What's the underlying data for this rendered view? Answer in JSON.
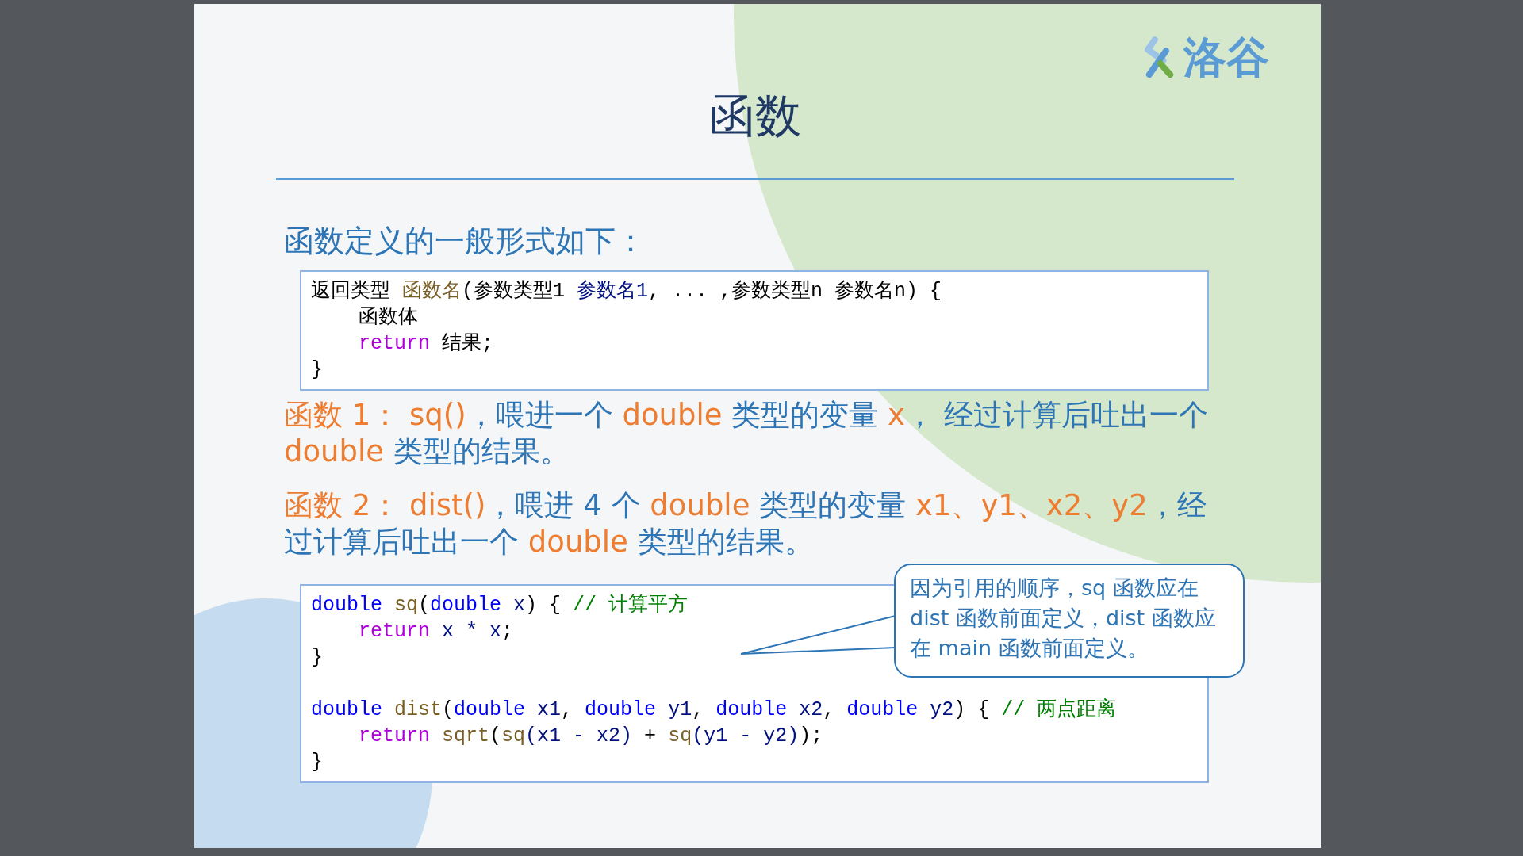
{
  "slide": {
    "logo": {
      "text": "洛谷"
    },
    "title": "函数",
    "heading": "函数定义的一般形式如下：",
    "code_blocks": [
      {
        "lines": [
          {
            "kind": "flush",
            "tokens": [
              {
                "kind": "plain",
                "text": "返回类型 "
              },
              {
                "kind": "func",
                "text": "函数名"
              },
              {
                "kind": "plain",
                "text": "(参数类型1 "
              },
              {
                "kind": "param",
                "text": "参数名1"
              },
              {
                "kind": "plain",
                "text": ", ... ,参数类型n 参数名n) {"
              }
            ]
          },
          {
            "kind": "indented",
            "tokens": [
              {
                "kind": "plain",
                "text": "函数体"
              }
            ]
          },
          {
            "kind": "indented",
            "tokens": [
              {
                "kind": "keyword",
                "text": "return"
              },
              {
                "kind": "plain",
                "text": " 结果;"
              }
            ]
          },
          {
            "kind": "flush",
            "tokens": [
              {
                "kind": "plain",
                "text": "}"
              }
            ]
          }
        ]
      },
      {
        "lines": [
          {
            "kind": "flush",
            "tokens": [
              {
                "kind": "type",
                "text": "double "
              },
              {
                "kind": "func",
                "text": "sq"
              },
              {
                "kind": "plain",
                "text": "("
              },
              {
                "kind": "type",
                "text": "double"
              },
              {
                "kind": "param",
                "text": " x"
              },
              {
                "kind": "plain",
                "text": ") { "
              },
              {
                "kind": "comment",
                "text": "// 计算平方"
              }
            ]
          },
          {
            "kind": "indented",
            "tokens": [
              {
                "kind": "keyword",
                "text": "return"
              },
              {
                "kind": "param",
                "text": " x * x"
              },
              {
                "kind": "plain",
                "text": ";"
              }
            ]
          },
          {
            "kind": "flush",
            "tokens": [
              {
                "kind": "plain",
                "text": "}"
              }
            ]
          },
          {
            "kind": "spaced",
            "tokens": [
              {
                "kind": "type",
                "text": "double "
              },
              {
                "kind": "func",
                "text": "dist"
              },
              {
                "kind": "plain",
                "text": "("
              },
              {
                "kind": "type",
                "text": "double"
              },
              {
                "kind": "param",
                "text": " x1"
              },
              {
                "kind": "plain",
                "text": ", "
              },
              {
                "kind": "type",
                "text": "double"
              },
              {
                "kind": "param",
                "text": " y1"
              },
              {
                "kind": "plain",
                "text": ", "
              },
              {
                "kind": "type",
                "text": "double"
              },
              {
                "kind": "param",
                "text": " x2"
              },
              {
                "kind": "plain",
                "text": ", "
              },
              {
                "kind": "type",
                "text": "double"
              },
              {
                "kind": "param",
                "text": " y2"
              },
              {
                "kind": "plain",
                "text": ") { "
              },
              {
                "kind": "comment",
                "text": "// 两点距离"
              }
            ]
          },
          {
            "kind": "indented",
            "tokens": [
              {
                "kind": "keyword",
                "text": "return "
              },
              {
                "kind": "func",
                "text": "sqrt"
              },
              {
                "kind": "plain",
                "text": "("
              },
              {
                "kind": "func",
                "text": "sq"
              },
              {
                "kind": "param",
                "text": "(x1 - x2)"
              },
              {
                "kind": "plain",
                "text": " + "
              },
              {
                "kind": "func",
                "text": "sq"
              },
              {
                "kind": "param",
                "text": "(y1 - y2)"
              },
              {
                "kind": "plain",
                "text": ");"
              }
            ]
          },
          {
            "kind": "flush",
            "tokens": [
              {
                "kind": "plain",
                "text": "}"
              }
            ]
          }
        ]
      }
    ],
    "paragraphs": [
      {
        "segments": [
          {
            "kind": "accent",
            "text": "函数 1：  sq()"
          },
          {
            "kind": "normal",
            "text": "，喂进一个 "
          },
          {
            "kind": "accent",
            "text": "double"
          },
          {
            "kind": "normal",
            "text": " 类型的变量 "
          },
          {
            "kind": "accent",
            "text": "x"
          },
          {
            "kind": "normal",
            "text": "，  经过计算后吐出一个 "
          },
          {
            "kind": "accent",
            "text": "double"
          },
          {
            "kind": "normal",
            "text": " 类型的结果。"
          }
        ]
      },
      {
        "segments": [
          {
            "kind": "accent",
            "text": "函数 2：  dist()"
          },
          {
            "kind": "normal",
            "text": "，喂进 4 个 "
          },
          {
            "kind": "accent",
            "text": "double"
          },
          {
            "kind": "normal",
            "text": " 类型的变量 "
          },
          {
            "kind": "accent",
            "text": "x1、y1、x2、y2"
          },
          {
            "kind": "normal",
            "text": "，经过计算后吐出一个 "
          },
          {
            "kind": "accent",
            "text": "double"
          },
          {
            "kind": "normal",
            "text": " 类型的结果。"
          }
        ]
      }
    ],
    "callout": {
      "text": "因为引用的顺序，sq 函数应在 dist 函数前面定义，dist 函数应在 main 函数前面定义。"
    }
  }
}
